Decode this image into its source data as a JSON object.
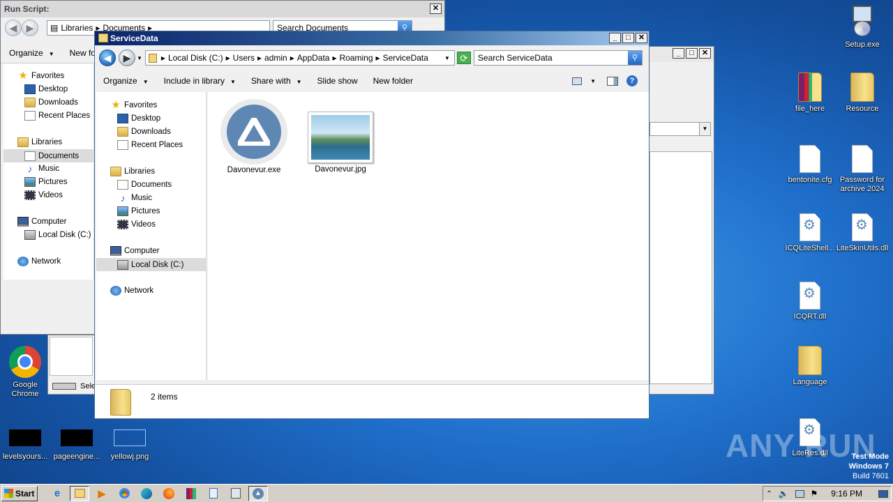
{
  "desktop": {
    "icons_right": [
      {
        "label": "Setup.exe"
      },
      {
        "label": "file_here"
      },
      {
        "label": "Resource"
      },
      {
        "label": "bentonite.cfg"
      },
      {
        "label": "Password for archive 2024"
      },
      {
        "label": "ICQLiteShell..."
      },
      {
        "label": "LiteSkinUtils.dll"
      },
      {
        "label": "ICQRT.dll"
      },
      {
        "label": "Language"
      },
      {
        "label": "LiteRes.dll"
      }
    ],
    "icons_left": [
      {
        "label": "Google Chrome"
      },
      {
        "label": "levelsyours..."
      },
      {
        "label": "pageengine..."
      },
      {
        "label": "yellowj.png"
      }
    ],
    "watermark": "ANY RUN",
    "os_info": {
      "line1": "Test Mode",
      "line2": "Windows 7",
      "line3": "Build 7601"
    }
  },
  "back_window": {
    "title": "Run Script:",
    "address": [
      "Libraries",
      "Documents"
    ],
    "search_placeholder": "Search Documents",
    "toolbar": {
      "organize": "Organize",
      "new_folder": "New fol"
    },
    "nav": {
      "favorites": "Favorites",
      "desktop": "Desktop",
      "downloads": "Downloads",
      "recent": "Recent Places",
      "libraries": "Libraries",
      "documents": "Documents",
      "music": "Music",
      "pictures": "Pictures",
      "videos": "Videos",
      "computer": "Computer",
      "localdisk": "Local Disk (C:)",
      "network": "Network"
    },
    "status_partial": "Sele"
  },
  "main_window": {
    "title": "ServiceData",
    "address": [
      "Local Disk (C:)",
      "Users",
      "admin",
      "AppData",
      "Roaming",
      "ServiceData"
    ],
    "search_placeholder": "Search ServiceData",
    "toolbar": {
      "organize": "Organize",
      "include": "Include in library",
      "share": "Share with",
      "slideshow": "Slide show",
      "new_folder": "New folder"
    },
    "nav": {
      "favorites": "Favorites",
      "desktop": "Desktop",
      "downloads": "Downloads",
      "recent": "Recent Places",
      "libraries": "Libraries",
      "documents": "Documents",
      "music": "Music",
      "pictures": "Pictures",
      "videos": "Videos",
      "computer": "Computer",
      "localdisk": "Local Disk (C:)",
      "network": "Network"
    },
    "files": [
      {
        "name": "Davonevur.exe"
      },
      {
        "name": "Davonevur.jpg"
      }
    ],
    "status": "2 items"
  },
  "taskbar": {
    "start": "Start",
    "time": "9:16 PM"
  }
}
